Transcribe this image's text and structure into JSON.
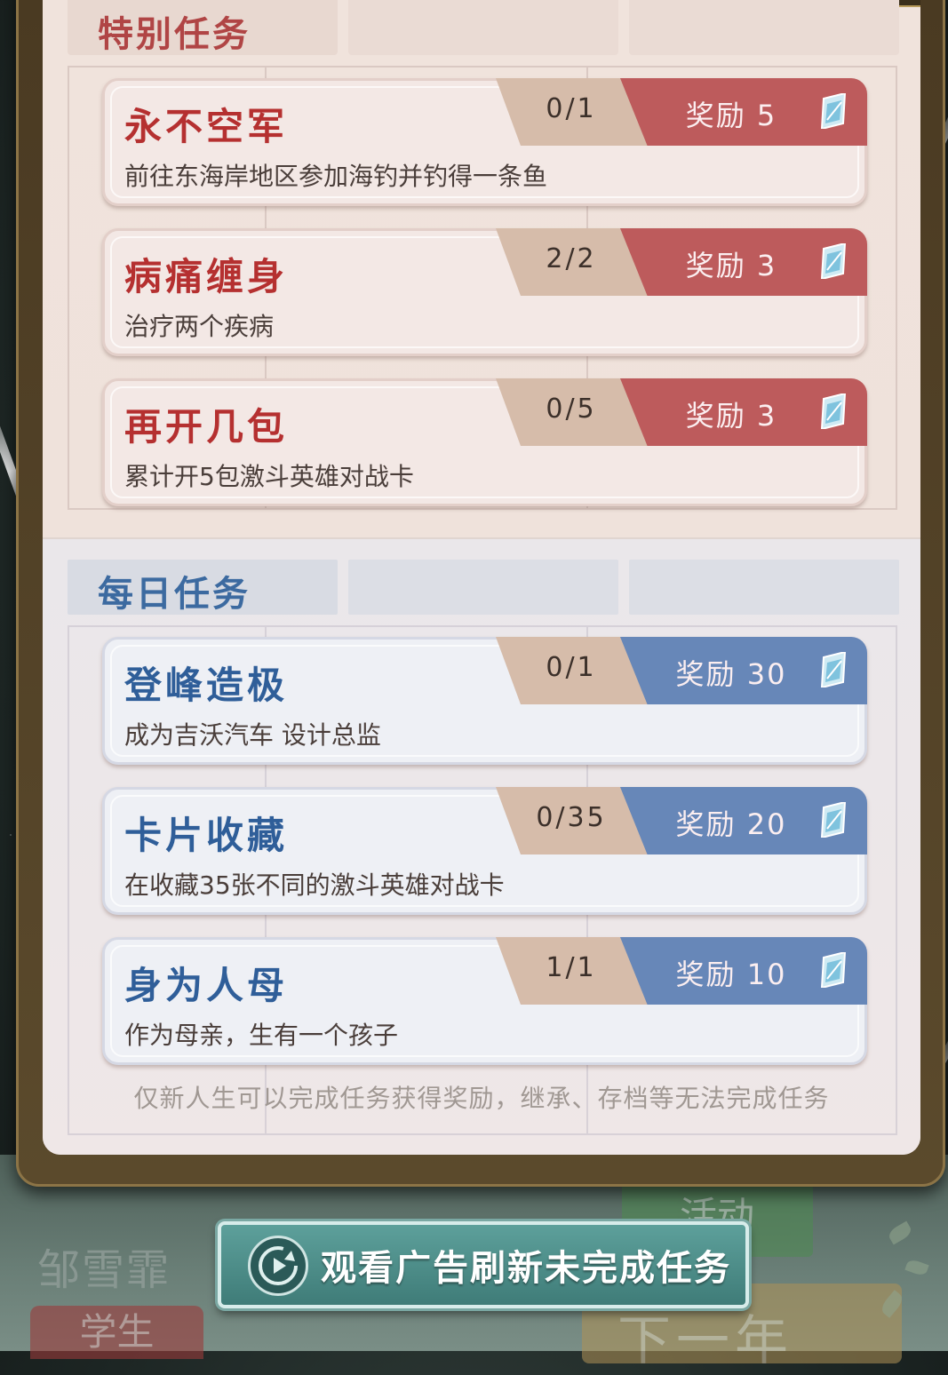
{
  "special_section": {
    "title": "特别任务",
    "tasks": [
      {
        "title": "永不空军",
        "desc": "前往东海岸地区参加海钓并钓得一条鱼",
        "progress": "0/1",
        "reward": "奖励 5"
      },
      {
        "title": "病痛缠身",
        "desc": "治疗两个疾病",
        "progress": "2/2",
        "reward": "奖励 3"
      },
      {
        "title": "再开几包",
        "desc": "累计开5包激斗英雄对战卡",
        "progress": "0/5",
        "reward": "奖励 3"
      }
    ]
  },
  "daily_section": {
    "title": "每日任务",
    "tasks": [
      {
        "title": "登峰造极",
        "desc": "成为吉沃汽车 设计总监",
        "progress": "0/1",
        "reward": "奖励 30"
      },
      {
        "title": "卡片收藏",
        "desc": "在收藏35张不同的激斗英雄对战卡",
        "progress": "0/35",
        "reward": "奖励 20"
      },
      {
        "title": "身为人母",
        "desc": "作为母亲，生有一个孩子",
        "progress": "1/1",
        "reward": "奖励 10"
      }
    ]
  },
  "footnote": "仅新人生可以完成任务获得奖励，继承、存档等无法完成任务",
  "ad_button": {
    "label": "观看广告刷新未完成任务",
    "icon": "replay-icon"
  },
  "background": {
    "character_name": "邹雪霏",
    "character_role": "学生",
    "activity_label": "活动",
    "next_year_label": "下一年"
  },
  "colors": {
    "special_accent": "#bd5b5c",
    "special_title": "#b53030",
    "daily_accent": "#6787b8",
    "daily_title": "#2f5e99",
    "ad_button": "#4f8e8a"
  },
  "reward_icon": "diamond-icon"
}
